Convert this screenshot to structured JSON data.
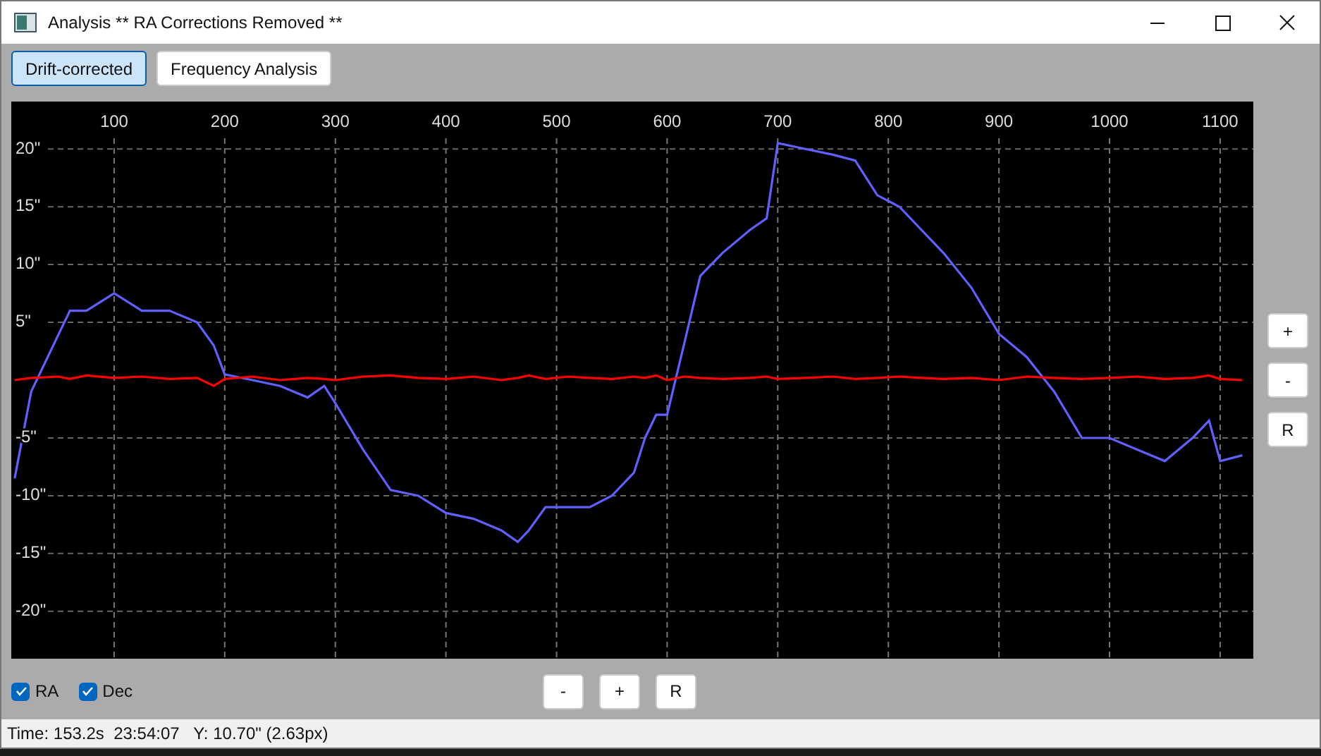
{
  "window": {
    "title": "Analysis ** RA Corrections Removed **"
  },
  "tabs": [
    {
      "label": "Drift-corrected",
      "selected": true
    },
    {
      "label": "Frequency Analysis",
      "selected": false
    }
  ],
  "chart_data": {
    "type": "line",
    "grid": true,
    "xlim": [
      7,
      1130
    ],
    "ylim": [
      -24.1,
      24.1
    ],
    "xticks": [
      100,
      200,
      300,
      400,
      500,
      600,
      700,
      800,
      900,
      1000,
      1100
    ],
    "yticks": [
      {
        "value": 20,
        "label": "20\""
      },
      {
        "value": 15,
        "label": "15\""
      },
      {
        "value": 10,
        "label": "10\""
      },
      {
        "value": 5,
        "label": "5\""
      },
      {
        "value": -5,
        "label": "-5\""
      },
      {
        "value": -10,
        "label": "-10\""
      },
      {
        "value": -15,
        "label": "-15\""
      },
      {
        "value": -20,
        "label": "-20\""
      }
    ],
    "x": [
      10,
      25,
      50,
      60,
      75,
      100,
      125,
      150,
      175,
      190,
      200,
      225,
      250,
      275,
      290,
      300,
      325,
      350,
      375,
      400,
      425,
      450,
      465,
      475,
      490,
      510,
      530,
      550,
      570,
      580,
      590,
      600,
      615,
      630,
      650,
      675,
      690,
      700,
      725,
      750,
      770,
      790,
      810,
      830,
      850,
      875,
      900,
      925,
      950,
      975,
      1000,
      1025,
      1050,
      1075,
      1090,
      1100,
      1120
    ],
    "series": [
      {
        "name": "RA",
        "color": "#6060ff",
        "values": [
          -8.5,
          -1,
          4,
          6,
          6,
          7.5,
          6,
          6,
          5,
          3,
          0.5,
          0,
          -0.5,
          -1.5,
          -0.5,
          -2,
          -6,
          -9.5,
          -10,
          -11.5,
          -12,
          -13,
          -14,
          -13,
          -11,
          -11,
          -11,
          -10,
          -8,
          -5,
          -3,
          -3,
          3,
          9,
          11,
          13,
          14,
          20.5,
          20,
          19.5,
          19,
          16,
          15,
          13,
          11,
          8,
          4,
          2,
          -1,
          -5,
          -5,
          -6,
          -7,
          -5,
          -3.5,
          -7,
          -6.5
        ]
      },
      {
        "name": "Dec",
        "color": "#ff0000",
        "values": [
          0,
          0.2,
          0.3,
          0.1,
          0.4,
          0.2,
          0.3,
          0.1,
          0.2,
          -0.5,
          0.1,
          0.3,
          0,
          0.2,
          0.1,
          0,
          0.3,
          0.4,
          0.2,
          0.1,
          0.3,
          0,
          0.2,
          0.4,
          0.1,
          0.3,
          0.2,
          0.1,
          0.3,
          0.2,
          0.4,
          0,
          0.3,
          0.2,
          0.1,
          0.2,
          0.3,
          0.1,
          0.2,
          0.3,
          0.1,
          0.2,
          0.3,
          0.2,
          0.1,
          0.2,
          0,
          0.3,
          0.2,
          0.1,
          0.2,
          0.3,
          0.1,
          0.2,
          0.4,
          0.1,
          0
        ]
      }
    ]
  },
  "y_zoom_buttons": [
    "+",
    "-",
    "R"
  ],
  "series_toggles": [
    {
      "checked": true
    },
    {
      "checked": true
    }
  ],
  "x_zoom_buttons": [
    "-",
    "+",
    "R"
  ],
  "status_bar": "Time: 153.2s  23:54:07   Y: 10.70\" (2.63px)"
}
